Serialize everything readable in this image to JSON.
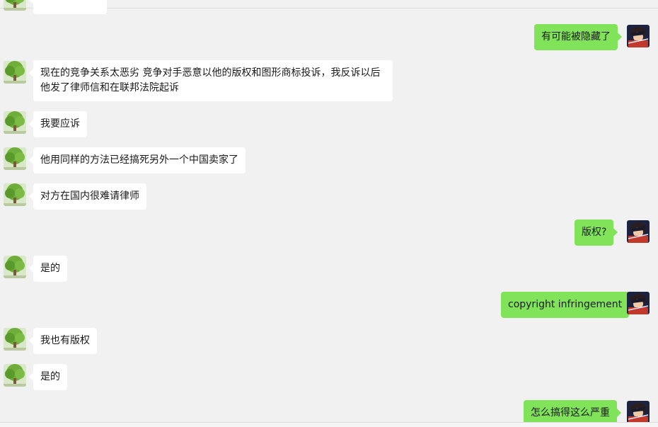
{
  "chat": {
    "messages": [
      {
        "side": "left",
        "text": "",
        "avatar": "tree-avatar"
      },
      {
        "side": "right",
        "text": "有可能被隐藏了",
        "avatar": "anime-avatar"
      },
      {
        "side": "left",
        "lines": [
          "现在的竞争关系太恶劣 竞争对手恶意以他的版权和图形商标投诉，我反诉以后",
          "他发了律师信和在联邦法院起诉"
        ],
        "avatar": "tree-avatar"
      },
      {
        "side": "left",
        "text": "我要应诉",
        "avatar": "tree-avatar"
      },
      {
        "side": "left",
        "text": "他用同样的方法已经搞死另外一个中国卖家了",
        "avatar": "tree-avatar"
      },
      {
        "side": "left",
        "text": "对方在国内很难请律师",
        "avatar": "tree-avatar"
      },
      {
        "side": "right",
        "text": "版权?",
        "avatar": "anime-avatar"
      },
      {
        "side": "left",
        "text": "是的",
        "avatar": "tree-avatar"
      },
      {
        "side": "right",
        "text": "copyright infringement",
        "avatar": "anime-avatar"
      },
      {
        "side": "left",
        "text": "我也有版权",
        "avatar": "tree-avatar"
      },
      {
        "side": "left",
        "text": "是的",
        "avatar": "tree-avatar"
      },
      {
        "side": "right",
        "text": "怎么搞得这么严重",
        "avatar": "anime-avatar"
      }
    ]
  },
  "colors": {
    "background": "#f1f1f1",
    "sent_bubble": "#80e35a",
    "received_bubble": "#ffffff"
  }
}
